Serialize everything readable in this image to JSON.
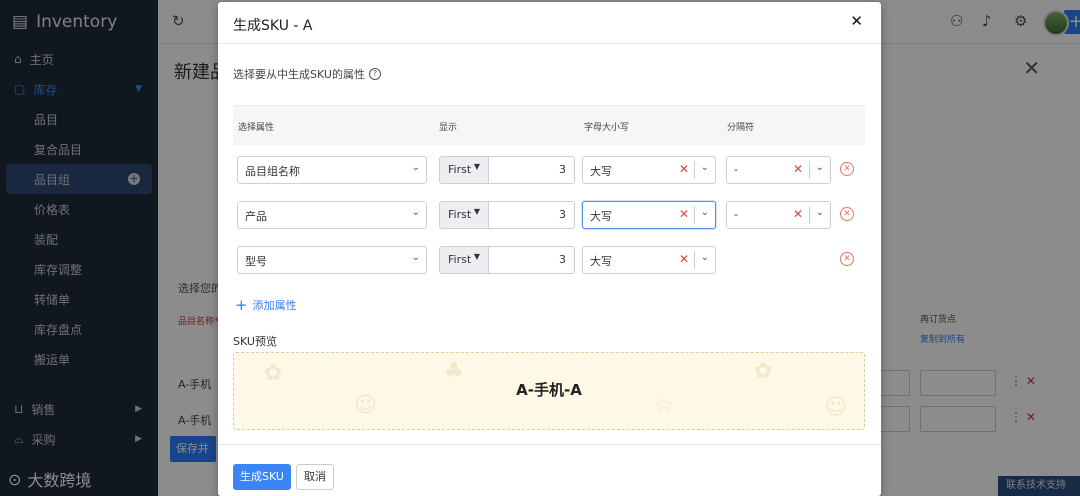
{
  "app": {
    "name": "Inventory",
    "sidebar": {
      "home": "主页",
      "inventory": "库存",
      "sub_items": [
        "品目",
        "复合品目",
        "品目组",
        "价格表",
        "装配",
        "库存调整",
        "转储单",
        "库存盘点",
        "搬运单"
      ],
      "sales": "销售",
      "purchase": "采购"
    },
    "watermark": "大数跨境"
  },
  "background": {
    "page_title": "新建品",
    "text_select": "选择您的",
    "text_red": "品目名称*",
    "rows": [
      "A-手机",
      "A-手机"
    ],
    "reorder_label": "再订货点",
    "copy_all": "复制到所有",
    "save_button": "保存并",
    "support": "联系技术支持"
  },
  "modal": {
    "title": "生成SKU - A",
    "instruction": "选择要从中生成SKU的属性",
    "headers": {
      "attribute": "选择属性",
      "display": "显示",
      "case": "字母大小写",
      "separator": "分隔符"
    },
    "rows": [
      {
        "attribute": "品目组名称",
        "display": "First",
        "count": "3",
        "case": "大写",
        "separator": "-"
      },
      {
        "attribute": "产品",
        "display": "First",
        "count": "3",
        "case": "大写",
        "separator": "-"
      },
      {
        "attribute": "型号",
        "display": "First",
        "count": "3",
        "case": "大写"
      }
    ],
    "add_attribute": "添加属性",
    "preview_label": "SKU预览",
    "preview_value": "A-手机-A",
    "generate_button": "生成SKU",
    "cancel_button": "取消"
  },
  "colors": {
    "primary": "#2d7ff9",
    "sidebar_bg": "#1f2a3a",
    "danger": "#e0473d",
    "preview_bg": "#fdf9e6"
  }
}
